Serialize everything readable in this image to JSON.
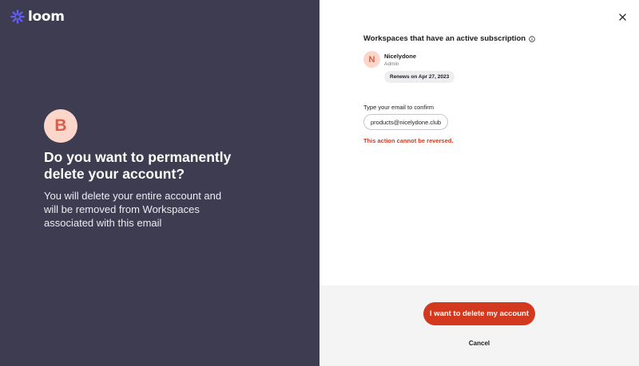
{
  "brand": {
    "name": "loom",
    "logo_icon": "loom-starburst-icon",
    "logo_color": "#625df5"
  },
  "left_panel": {
    "avatar_letter": "B",
    "headline": "Do you want to permanently delete your account?",
    "description": "You will delete your entire account and will be removed from Workspaces associated with this email"
  },
  "dialog": {
    "close_icon": "close-icon",
    "workspaces_title": "Workspaces that have an active subscription",
    "workspaces": [
      {
        "avatar_letter": "N",
        "name": "Nicelydone",
        "role": "Admin",
        "renewal": "Renews on Apr 27, 2023"
      }
    ],
    "confirm_label": "Type your email to confirm",
    "email_value": "products@nicelydone.club",
    "warning": "This action cannot be reversed."
  },
  "footer": {
    "delete_label": "I want to delete my account",
    "cancel_label": "Cancel"
  },
  "colors": {
    "left_panel_bg": "#3e3c51",
    "danger": "#d3391f",
    "avatar_bg": "#fcd6cb",
    "avatar_fg": "#d95d49",
    "footer_bg": "#f4f4f5"
  }
}
